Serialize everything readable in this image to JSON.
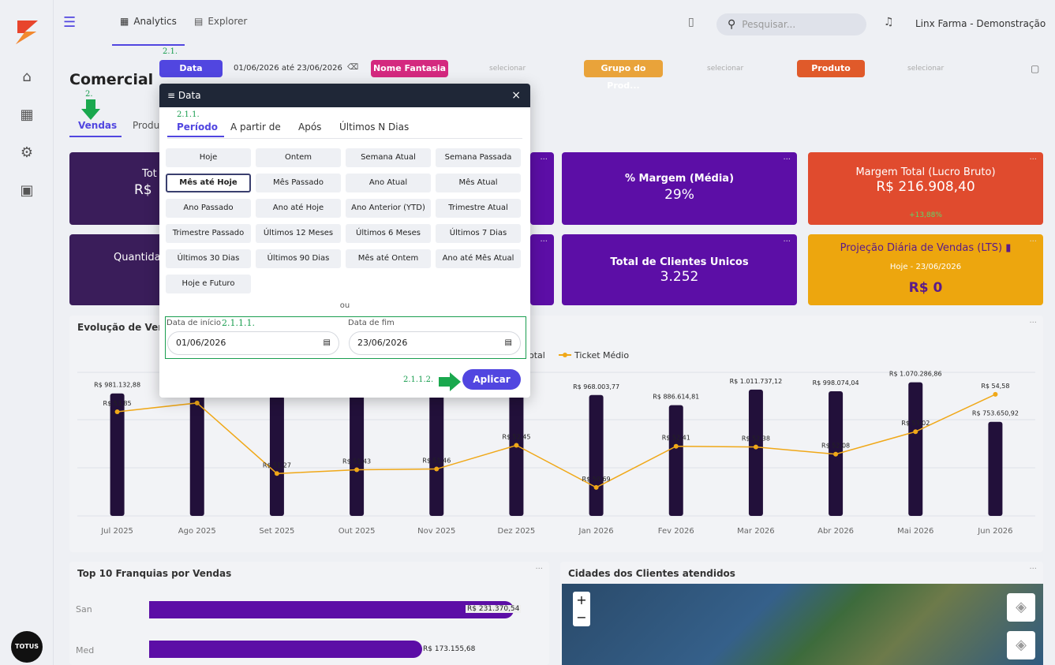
{
  "nav": {
    "tab_analytics": "Analytics",
    "tab_explorer": "Explorer",
    "search_placeholder": "Pesquisar...",
    "company": "Linx Farma - Demonstração"
  },
  "sidebar": {
    "brand": "TOTUS"
  },
  "page": {
    "title": "Comercial",
    "tabs": [
      "Vendas",
      "Produ"
    ]
  },
  "filters": {
    "data_label": "Data",
    "data_value": "01/06/2026 até 23/06/2026",
    "nome_label": "Nome Fantasia",
    "grupo_label": "Grupo do Prod...",
    "produto_label": "Produto",
    "select_text": "selecionar"
  },
  "annotations": {
    "a21": "2.1.",
    "a2": "2.",
    "a211": "2.1.1.",
    "a2111": "2.1.1.1.",
    "a2112": "2.1.1.2."
  },
  "cards": {
    "c1_title": "Tot",
    "c1_value": "R$",
    "margem_title": "% Margem (Média)",
    "margem_value": "29%",
    "lucro_title": "Margem Total (Lucro Bruto)",
    "lucro_value": "R$ 216.908,40",
    "lucro_delta": "+13,88%",
    "qtd_title": "Quantida",
    "clientes_title": "Total de Clientes Unicos",
    "clientes_value": "3.252",
    "proj_title": "Projeção Diária de Vendas (LTS)",
    "proj_sub": "Hoje - 23/06/2026",
    "proj_value": "R$ 0"
  },
  "modal": {
    "title": "Data",
    "close": "×",
    "tabs": [
      "Período",
      "A partir de",
      "Após",
      "Últimos N Dias"
    ],
    "options": [
      "Hoje",
      "Ontem",
      "Semana Atual",
      "Semana Passada",
      "Mês até Hoje",
      "Mês Passado",
      "Ano Atual",
      "Mês Atual",
      "Ano Passado",
      "Ano até Hoje",
      "Ano Anterior (YTD)",
      "Trimestre Atual",
      "Trimestre Passado",
      "Últimos 12 Meses",
      "Últimos 6 Meses",
      "Últimos 7 Dias",
      "Últimos 30 Dias",
      "Últimos 90 Dias",
      "Mês até Ontem",
      "Ano até Mês Atual",
      "Hoje e Futuro"
    ],
    "selected": "Mês até Hoje",
    "ou": "ou",
    "start_label": "Data de início",
    "start_value": "01/06/2026",
    "end_label": "Data de fim",
    "end_value": "23/06/2026",
    "apply": "Aplicar"
  },
  "chart_data": {
    "type": "bar",
    "title": "Evolução de Vend",
    "legend": [
      "otal",
      "Ticket Médio"
    ],
    "categories": [
      "Jul 2025",
      "Ago 2025",
      "Set 2025",
      "Out 2025",
      "Nov 2025",
      "Dez 2025",
      "Jan 2026",
      "Fev 2026",
      "Mar 2026",
      "Abr 2026",
      "Mai 2026",
      "Jun 2026"
    ],
    "bar_labels": [
      "R$ 981.132,88",
      "",
      "",
      "",
      "",
      "8,00",
      "R$ 968.003,77",
      "R$ 886.614,81",
      "R$ 1.011.737,12",
      "R$ 998.074,04",
      "R$ 1.070.286,86",
      "R$ 753.650,92"
    ],
    "bar_values": [
      981132.88,
      1010000,
      960000,
      990000,
      970000,
      1008000,
      968003.77,
      886614.81,
      1011737.12,
      998074.04,
      1070286.86,
      753650.92
    ],
    "line_values": [
      53.85,
      54.22,
      51.27,
      51.43,
      51.46,
      52.45,
      50.69,
      52.41,
      52.38,
      52.08,
      53.02,
      54.58
    ],
    "line_labels": [
      "R$ 53,85",
      "R$ 54,22",
      "R$ 51,27",
      "R$ 51,43",
      "R$ 51,46",
      "R$ 52,45",
      "R$ 50,69",
      "R$ 52,41",
      "R$ 52,38",
      "R$ 52,08",
      "R$ 53,02",
      "R$ 54,58"
    ],
    "bar_color": "#22103a",
    "line_color": "#f0a818"
  },
  "franquias": {
    "title": "Top 10 Franquias por Vendas",
    "rows": [
      {
        "label": "San",
        "value": "R$ 231.370,54",
        "frac": 1.0
      },
      {
        "label": "Med",
        "value": "R$ 173.155,68",
        "frac": 0.748
      }
    ]
  },
  "cidades": {
    "title": "Cidades dos Clientes atendidos",
    "zoom_in": "+",
    "zoom_out": "−"
  }
}
